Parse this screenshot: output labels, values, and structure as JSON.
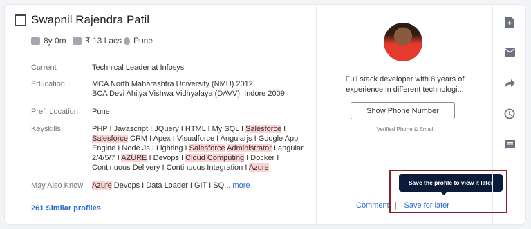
{
  "candidate": {
    "name": "Swapnil Rajendra Patil",
    "experience": "8y 0m",
    "salary": "₹ 13 Lacs",
    "location": "Pune"
  },
  "details": {
    "current_label": "Current",
    "current_value": "Technical Leader at Infosys",
    "education_label": "Education",
    "education_line1": "MCA North Maharashtra University (NMU) 2012",
    "education_line2": "BCA Devi Ahilya Vishwa Vidhyalaya (DAVV), Indore 2009",
    "pref_location_label": "Pref. Location",
    "pref_location_value": "Pune",
    "keyskills_label": "Keyskills",
    "keyskills": {
      "t1": "PHP I Javascript I JQuery I HTML I My SQL I ",
      "h1": "Salesforce",
      "t2": " I",
      "h2": "Salesforce",
      "t3": " CRM I Apex I Visualforce I Angularjs I Google App Engine I Node.Js I Lighting I ",
      "h3": "Salesforce",
      "t4": " ",
      "h4": "Administrator",
      "t5": " I angular 2/4/5/7 I ",
      "h5": "AZURE",
      "t6": " I Devops I ",
      "h6": "Cloud Computing",
      "t7": " I Docker I Continuous Delivery I Continuous Integration I ",
      "h7": "Azure"
    },
    "may_also_know_label": "May Also Know",
    "may_also_know_highlight": "Azure",
    "may_also_know_text": " Devops I Data Loader I GIT I SQ...",
    "more_label": "more",
    "similar_profiles": "261 Similar profiles"
  },
  "profile": {
    "about": "Full stack developer with 8 years of experience in different technologi...",
    "show_phone_label": "Show Phone Number",
    "verified_label": "Verified Phone & Email",
    "tooltip": "Save the profile to view it later",
    "comment_label": "Comment",
    "separator": "|",
    "save_later_label": "Save for later"
  },
  "sidebar_icons": [
    "download-cv-icon",
    "mail-icon",
    "share-icon",
    "clock-icon",
    "comment-icon"
  ],
  "colors": {
    "accent": "#2a6bd6",
    "highlight": "#fbd3d3",
    "tooltip_bg": "#0d1b3a",
    "frame": "#8b1f2c"
  }
}
